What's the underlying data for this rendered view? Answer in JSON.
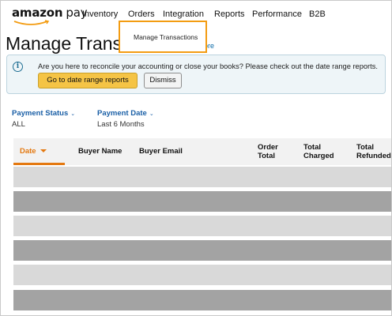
{
  "brand": {
    "name_bold": "amazon",
    "name_light": "pay"
  },
  "nav": [
    {
      "label": "Inventory"
    },
    {
      "label": "Orders"
    },
    {
      "label": "Integration"
    },
    {
      "label": "Reports"
    },
    {
      "label": "Performance"
    },
    {
      "label": "B2B"
    }
  ],
  "dropdown": {
    "item": "Manage Transactions",
    "highlight_color": "#f39c12"
  },
  "page": {
    "title": "Manage Transactions",
    "learn_more": "Learn more"
  },
  "info": {
    "text": "Are you here to reconcile your accounting or close your books? Please check out the date range reports.",
    "primary_button": "Go to date range reports",
    "secondary_button": "Dismiss"
  },
  "filters": [
    {
      "label": "Payment Status",
      "value": "ALL"
    },
    {
      "label": "Payment Date",
      "value": "Last 6 Months"
    }
  ],
  "table": {
    "columns": [
      {
        "label": "Date"
      },
      {
        "label": "Buyer Name"
      },
      {
        "label": "Buyer Email"
      },
      {
        "label": "Order\nTotal"
      },
      {
        "label": "Total\nCharged"
      },
      {
        "label": "Total\nRefunded"
      }
    ],
    "sorted_column": "Date",
    "rows_shown": 6,
    "accent_color": "#e47911"
  },
  "colors": {
    "primary_button": "#f5c445",
    "link": "#1a5fa6",
    "info_bg": "#eef5f8"
  }
}
